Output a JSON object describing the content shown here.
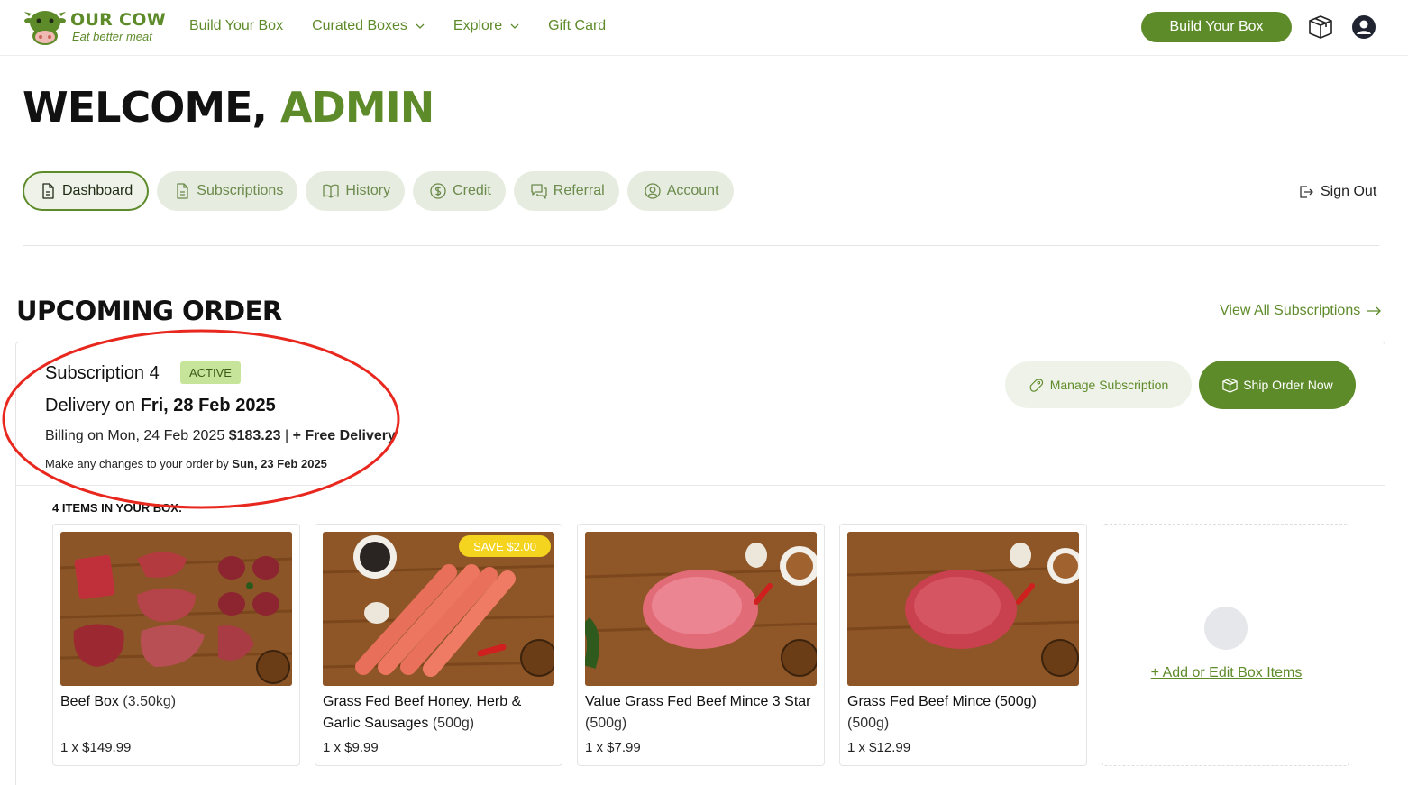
{
  "brand": {
    "name": "OUR COW",
    "tagline": "Eat better meat",
    "accent": "#5e8b2a"
  },
  "nav": {
    "items": [
      {
        "label": "Build Your Box"
      },
      {
        "label": "Curated Boxes",
        "dropdown": true
      },
      {
        "label": "Explore",
        "dropdown": true
      },
      {
        "label": "Gift Card"
      }
    ],
    "cta": "Build Your Box",
    "icons": [
      "box-icon",
      "user-icon"
    ]
  },
  "welcome": {
    "greeting": "WELCOME,",
    "name": "ADMIN"
  },
  "tabs": [
    {
      "label": "Dashboard",
      "icon": "document-icon",
      "active": true
    },
    {
      "label": "Subscriptions",
      "icon": "document-icon"
    },
    {
      "label": "History",
      "icon": "book-icon"
    },
    {
      "label": "Credit",
      "icon": "dollar-icon"
    },
    {
      "label": "Referral",
      "icon": "chat-icon"
    },
    {
      "label": "Account",
      "icon": "user-circle-icon"
    }
  ],
  "sign_out": "Sign Out",
  "upcoming": {
    "title": "UPCOMING ORDER",
    "view_all": "View All Subscriptions",
    "subscription_name": "Subscription 4",
    "status": "ACTIVE",
    "delivery_prefix": "Delivery on",
    "delivery_date": "Fri, 28 Feb 2025",
    "billing_prefix": "Billing on Mon, 24 Feb 2025",
    "billing_amount": "$183.23",
    "billing_separator": "|",
    "billing_delivery": "+ Free Delivery",
    "changes_prefix": "Make any changes to your order by",
    "changes_date": "Sun, 23 Feb 2025",
    "manage_label": "Manage Subscription",
    "ship_label": "Ship Order Now",
    "items_label": "4 ITEMS IN YOUR BOX:",
    "items": [
      {
        "name": "Beef Box",
        "weight": "(3.50kg)",
        "qty": "1 x $149.99"
      },
      {
        "name": "Grass Fed Beef Honey, Herb & Garlic Sausages",
        "weight": "(500g)",
        "qty": "1 x $9.99",
        "badge": "SAVE $2.00"
      },
      {
        "name": "Value Grass Fed Beef Mince 3 Star",
        "weight": "(500g)",
        "qty": "1 x $7.99"
      },
      {
        "name": "Grass Fed Beef Mince (500g)",
        "weight": "(500g)",
        "qty": "1 x $12.99"
      }
    ],
    "add_edit": "+ Add or Edit Box Items"
  },
  "annotation_color": "#e8281e"
}
